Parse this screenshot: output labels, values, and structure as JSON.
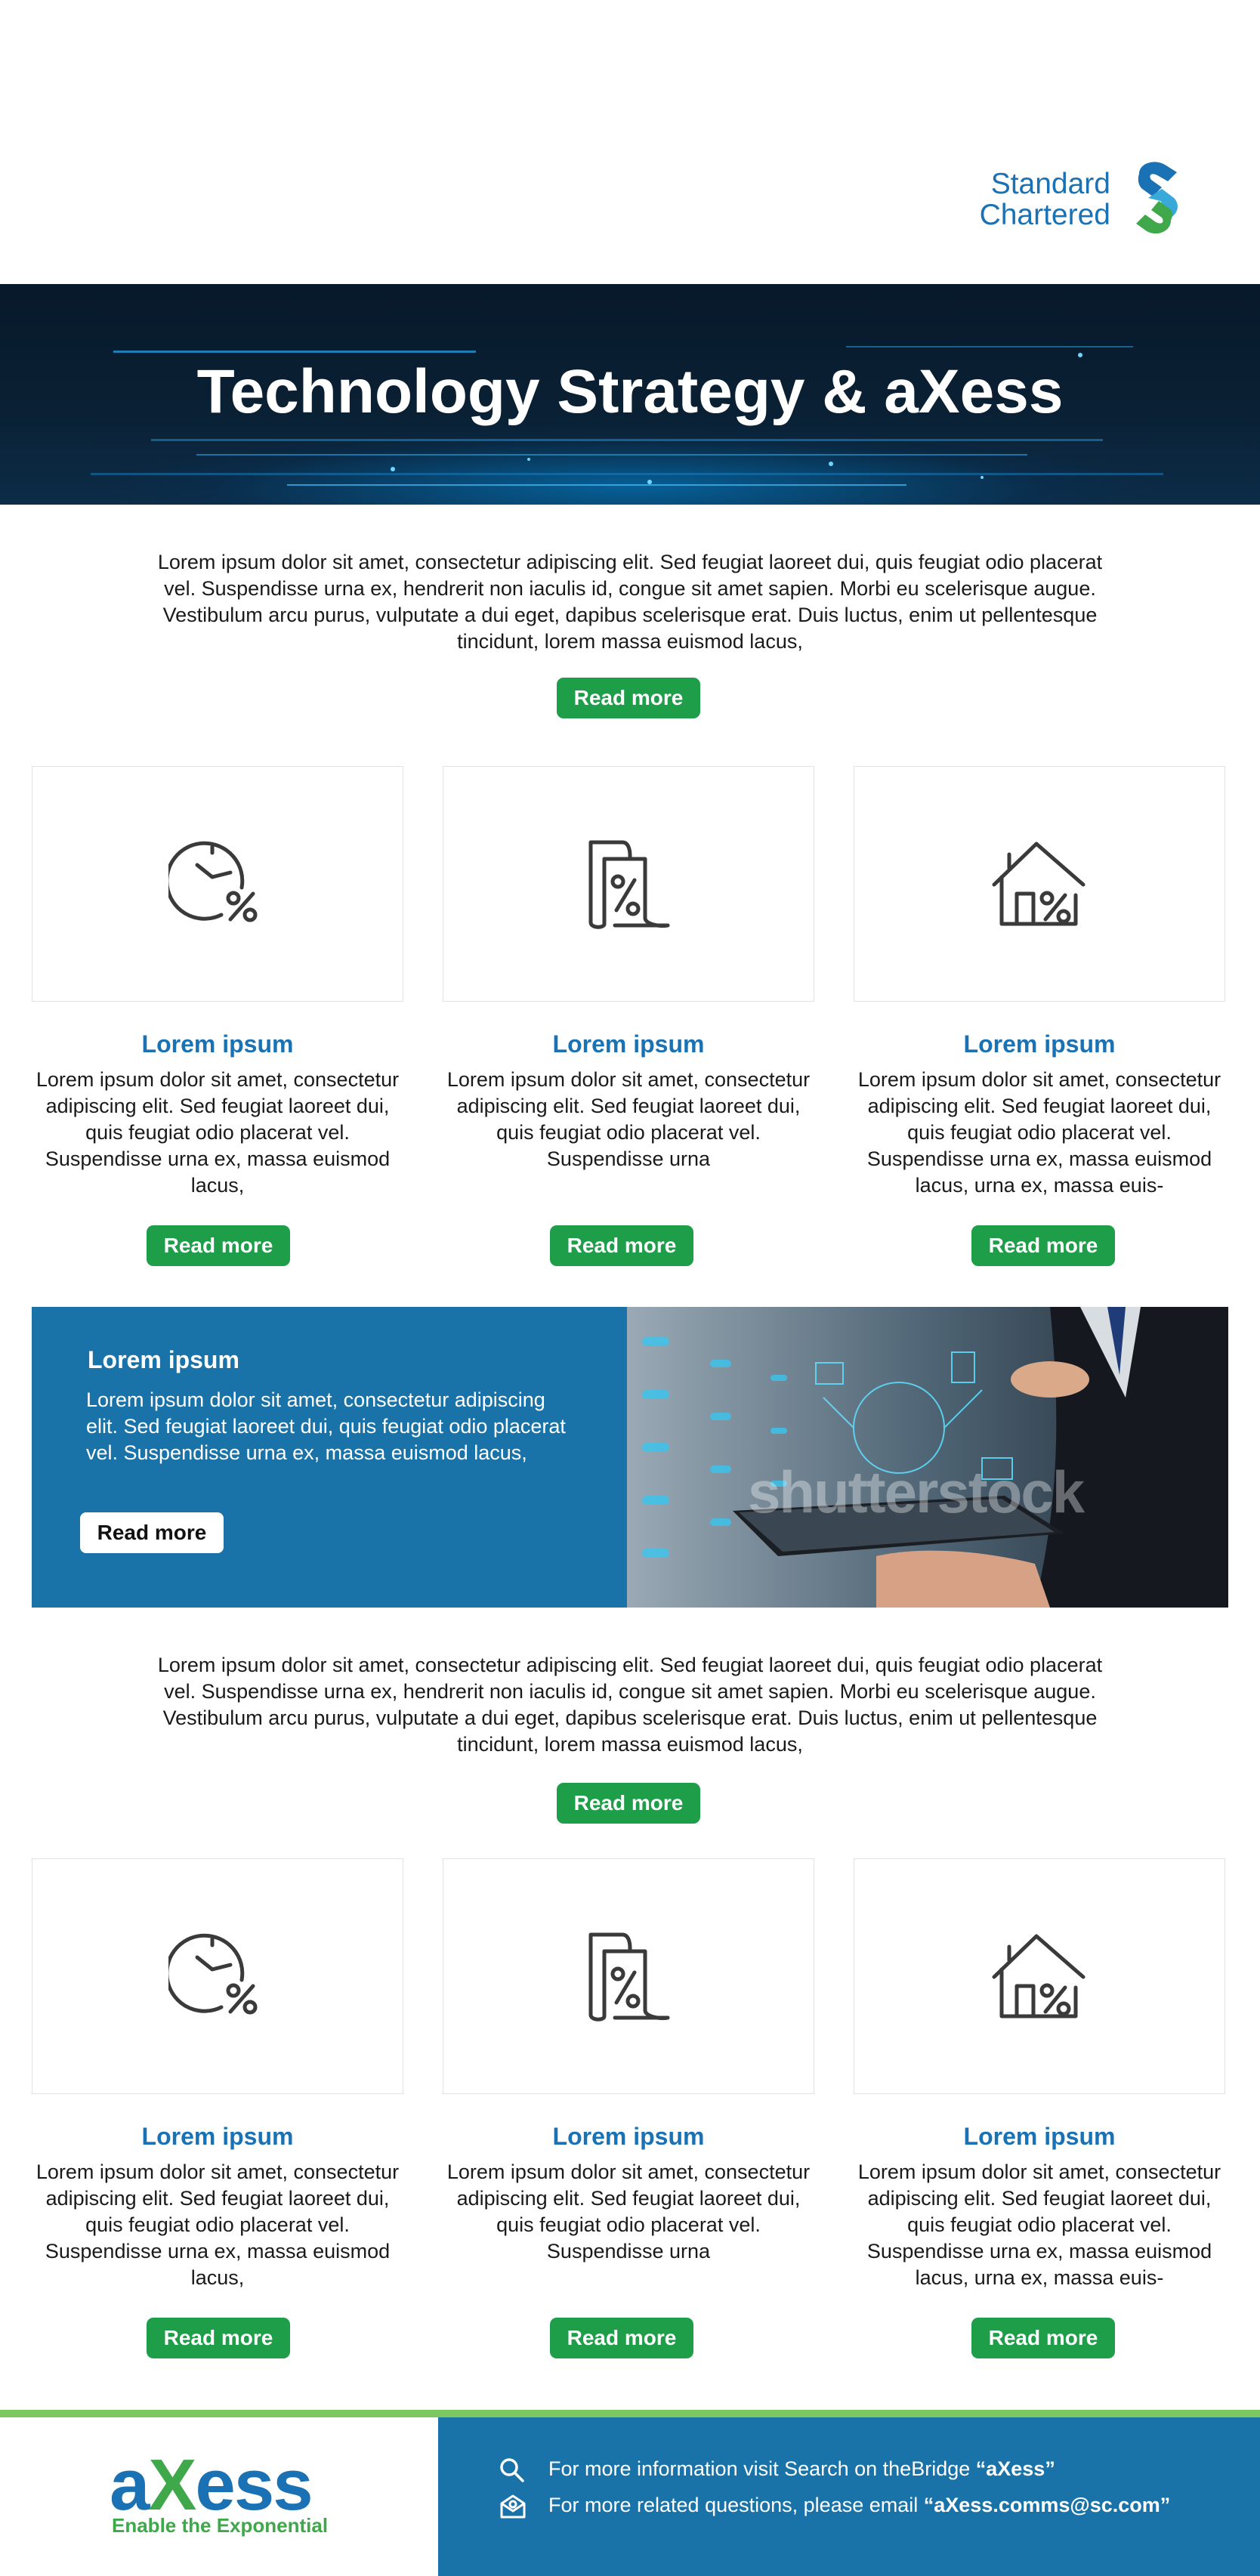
{
  "brand": {
    "logo_line1": "Standard",
    "logo_line2": "Chartered"
  },
  "hero": {
    "title": "Technology Strategy & aXess"
  },
  "intro": {
    "text": "Lorem ipsum dolor sit amet, consectetur adipiscing elit. Sed feugiat laoreet dui, quis feugiat odio placerat vel. Suspendisse urna ex, hendrerit non iaculis id, congue sit amet sapien. Morbi eu scelerisque augue. Vestibulum arcu purus, vulputate a dui eget, dapibus scelerisque erat. Duis luctus, enim ut pellentesque tincidunt, lorem massa euismod lacus,",
    "button": "Read more"
  },
  "cards_top": [
    {
      "icon": "clock-percent-icon",
      "title": "Lorem ipsum",
      "text": "Lorem ipsum dolor sit amet, consectetur adipiscing elit. Sed feugiat laoreet dui, quis feugiat odio placerat vel. Suspendisse urna ex, massa euismod lacus,",
      "button": "Read more"
    },
    {
      "icon": "document-percent-icon",
      "title": "Lorem ipsum",
      "text": "Lorem ipsum dolor sit amet, consectetur adipiscing elit. Sed feugiat laoreet dui, quis feugiat odio placerat vel. Suspendisse urna",
      "button": "Read more"
    },
    {
      "icon": "house-percent-icon",
      "title": "Lorem ipsum",
      "text": "Lorem ipsum dolor sit amet, consectetur adipiscing elit. Sed feugiat laoreet dui, quis feugiat odio placerat vel. Suspendisse urna ex, massa euismod lacus,  urna ex, massa euis-",
      "button": "Read more"
    }
  ],
  "promo": {
    "title": "Lorem ipsum",
    "text": "Lorem ipsum dolor sit amet, consectetur adipiscing elit. Sed feugiat laoreet dui, quis feugiat odio placerat vel. Suspendisse urna ex, massa euismod lacus,",
    "button": "Read more",
    "image_watermark": "shutterstock"
  },
  "mid": {
    "text": "Lorem ipsum dolor sit amet, consectetur adipiscing elit. Sed feugiat laoreet dui, quis feugiat odio placerat vel. Suspendisse urna ex, hendrerit non iaculis id, congue sit amet sapien. Morbi eu scelerisque augue. Vestibulum arcu purus, vulputate a dui eget, dapibus scelerisque erat. Duis luctus, enim ut pellentesque tincidunt, lorem massa euismod lacus,",
    "button": "Read more"
  },
  "cards_bottom": [
    {
      "icon": "clock-percent-icon",
      "title": "Lorem ipsum",
      "text": "Lorem ipsum dolor sit amet, consectetur adipiscing elit. Sed feugiat laoreet dui, quis feugiat odio placerat vel. Suspendisse urna ex, massa euismod lacus,",
      "button": "Read more"
    },
    {
      "icon": "document-percent-icon",
      "title": "Lorem ipsum",
      "text": "Lorem ipsum dolor sit amet, consectetur adipiscing elit. Sed feugiat laoreet dui, quis feugiat odio placerat vel. Suspendisse urna",
      "button": "Read more"
    },
    {
      "icon": "house-percent-icon",
      "title": "Lorem ipsum",
      "text": "Lorem ipsum dolor sit amet, consectetur adipiscing elit. Sed feugiat laoreet dui, quis feugiat odio placerat vel. Suspendisse urna ex, massa euismod lacus,  urna ex, massa euis-",
      "button": "Read more"
    }
  ],
  "footer": {
    "brand_a": "a",
    "brand_x": "X",
    "brand_ess": "ess",
    "tagline": "Enable the Exponential",
    "info_prefix": "For more information visit Search on theBridge ",
    "info_highlight": "“aXess”",
    "email_prefix": "For more related questions, please email ",
    "email_highlight": "“aXess.comms@sc.com”"
  },
  "colors": {
    "brand_blue": "#1a72b4",
    "button_green": "#1f9e4a",
    "promo_blue": "#1a73a8",
    "footer_green": "#7bc862"
  }
}
